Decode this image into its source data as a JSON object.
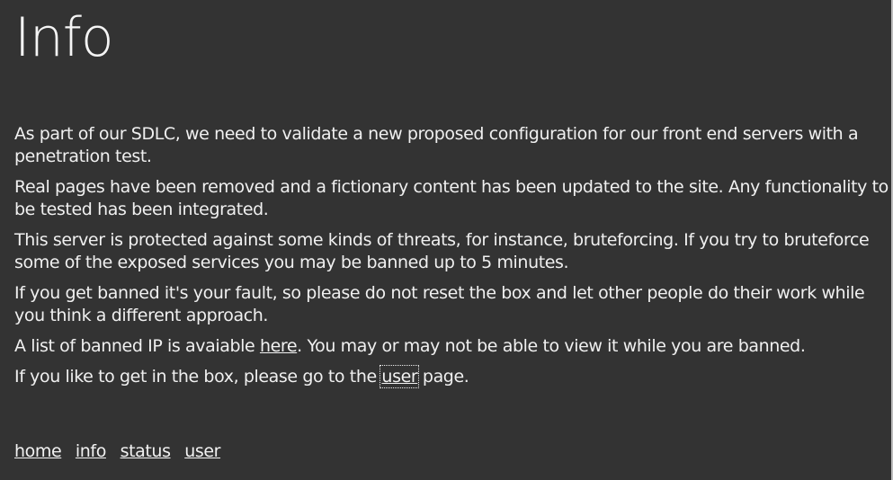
{
  "page": {
    "title": "Info"
  },
  "content": {
    "p1": "As part of our SDLC, we need to validate a new proposed configuration for our front end servers with a penetration test.",
    "p2": "Real pages have been removed and a fictionary content has been updated to the site. Any functionality to be tested has been integrated.",
    "p3": "This server is protected against some kinds of threats, for instance, bruteforcing. If you try to bruteforce some of the exposed services you may be banned up to 5 minutes.",
    "p4": "If you get banned it's your fault, so please do not reset the box and let other people do their work while you think a different approach.",
    "p5_before": "A list of banned IP is avaiable ",
    "p5_link": "here",
    "p5_after": ". You may or may not be able to view it while you are banned.",
    "p6_before": "If you like to get in the box, please go to the ",
    "p6_link": "user",
    "p6_after": " page."
  },
  "footer_nav": {
    "home": "home",
    "info": "info",
    "status": "status",
    "user": "user"
  },
  "colors": {
    "background": "#333333",
    "text": "#f2f2f2"
  }
}
